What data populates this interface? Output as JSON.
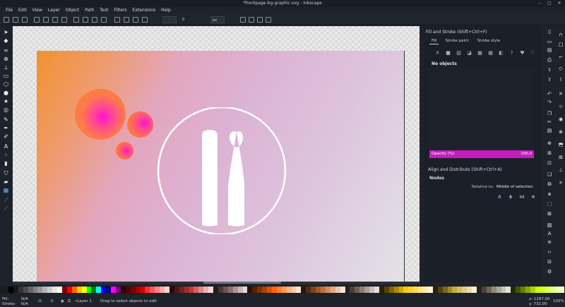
{
  "window": {
    "title": "*frontpage-bg-graphic.svg - Inkscape"
  },
  "menu": [
    "File",
    "Edit",
    "View",
    "Layer",
    "Object",
    "Path",
    "Text",
    "Filters",
    "Extensions",
    "Help"
  ],
  "controls": {
    "x_value": "0",
    "unit": "px"
  },
  "fill_stroke": {
    "title": "Fill and Stroke (Shift+Ctrl+F)",
    "tabs": [
      "Fill",
      "Stroke paint",
      "Stroke style"
    ],
    "no_objects": "No objects",
    "opacity_label": "Opacity (%)",
    "opacity_value": "100,0"
  },
  "align": {
    "title": "Align and Distribute (Shift+Ctrl+A)",
    "nodes_label": "Nodes",
    "relative_label": "Relative to:",
    "relative_value": "Middle of selection"
  },
  "status": {
    "fill_label": "Fill:",
    "fill_value": "N/A",
    "stroke_label": "Stroke:",
    "stroke_value": "N/A",
    "o_label": "O:",
    "layer": "•Layer 1",
    "message": "Drag to select objects to edit",
    "x": "x: 1287,00",
    "y": "y: 732,00",
    "zoom": "100%"
  },
  "colors": {
    "accent": "#c51dbd",
    "panel_bg": "#1b1f27",
    "gradient_start": "#f0932f",
    "gradient_end": "#e3e2e8"
  },
  "palette": [
    "#000000",
    "#1a1a1a",
    "#333333",
    "#4d4d4d",
    "#666666",
    "#808080",
    "#999999",
    "#b3b3b3",
    "#cccccc",
    "#e6e6e6",
    "#ffffff",
    "#800000",
    "#ff0000",
    "#ff6600",
    "#ffcc00",
    "#ffff00",
    "#00ff00",
    "#008000",
    "#00ffff",
    "#0000ff",
    "#000080",
    "#ff00ff",
    "#800080",
    "#2b0000",
    "#550000",
    "#800000",
    "#aa0000",
    "#d40000",
    "#ff2a2a",
    "#ff5555",
    "#ff8080",
    "#ffaaaa",
    "#ffd5d5",
    "#280b0b",
    "#501616",
    "#782121",
    "#a02c2c",
    "#c83737",
    "#d35f5f",
    "#de8787",
    "#e9afaf",
    "#f4d7d7",
    "#241c1c",
    "#483737",
    "#6c5353",
    "#916f6f",
    "#ac9393",
    "#c8b7b7",
    "#e3dbdb",
    "#2b1100",
    "#552200",
    "#803300",
    "#aa4400",
    "#d45500",
    "#ff6600",
    "#ff7f2a",
    "#ff9955",
    "#ffb380",
    "#ffccaa",
    "#ffe6d5",
    "#28170b",
    "#502d16",
    "#784421",
    "#a05a2c",
    "#c87137",
    "#d38d5f",
    "#deaa87",
    "#e9c6af",
    "#f4e3d7",
    "#241f1c",
    "#483e37",
    "#6c5d53",
    "#917c6f",
    "#ac9d93",
    "#c8beb7",
    "#e3dedb",
    "#2b2200",
    "#554400",
    "#806600",
    "#aa8800",
    "#d4aa00",
    "#ffcc00",
    "#ffd42a",
    "#ffdd55",
    "#ffe680",
    "#ffeeaa",
    "#fff6d5",
    "#28220b",
    "#504416",
    "#786721",
    "#a0892c",
    "#c8ab37",
    "#d3bc5f",
    "#decd87",
    "#e9ddaf",
    "#f4eed7",
    "#24221c",
    "#484537",
    "#6c6753",
    "#918a6f",
    "#aca793",
    "#c8c4b7",
    "#e3e2db",
    "#222b00",
    "#445500",
    "#668000",
    "#88aa00",
    "#aad400",
    "#ccff00",
    "#d4ff2a",
    "#ddff55",
    "#e5ff80",
    "#eeffaa",
    "#f6ffd5"
  ]
}
